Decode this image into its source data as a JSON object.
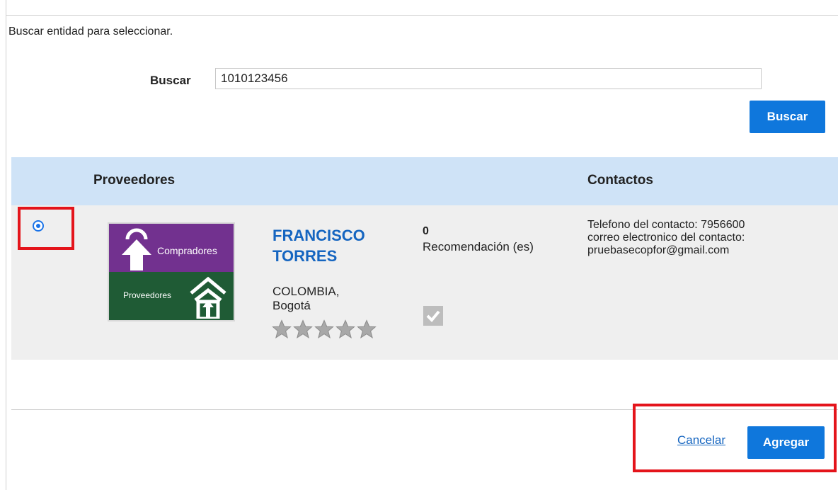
{
  "instruction": "Buscar entidad para seleccionar.",
  "search": {
    "label": "Buscar",
    "value": "1010123456",
    "button_label": "Buscar"
  },
  "table": {
    "headers": {
      "providers": "Proveedores",
      "contacts": "Contactos"
    },
    "rows": [
      {
        "selected": true,
        "logo": {
          "top_text": "Compradores",
          "bottom_text": "Proveedores"
        },
        "name_line1": "FRANCISCO",
        "name_line2": "TORRES",
        "location_line1": "COLOMBIA,",
        "location_line2": "Bogotá",
        "rating": 0,
        "rating_max": 5,
        "recommendations_count": "0",
        "recommendations_label": "Recomendación (es)",
        "contact_phone": "Telefono del contacto: 7956600",
        "contact_email_label": "correo electronico del contacto:",
        "contact_email": "pruebasecopfor@gmail.com"
      }
    ]
  },
  "footer": {
    "cancel_label": "Cancelar",
    "add_label": "Agregar"
  },
  "colors": {
    "primary": "#0f77dc",
    "link": "#1565c0",
    "header_bg": "#cfe3f7",
    "row_bg": "#efefef",
    "highlight": "#e4141b",
    "logo_purple": "#72318f",
    "logo_green": "#1f5b35"
  },
  "icons": {
    "radio": "radio-selected-icon",
    "star": "star-icon",
    "verified": "check-icon"
  }
}
